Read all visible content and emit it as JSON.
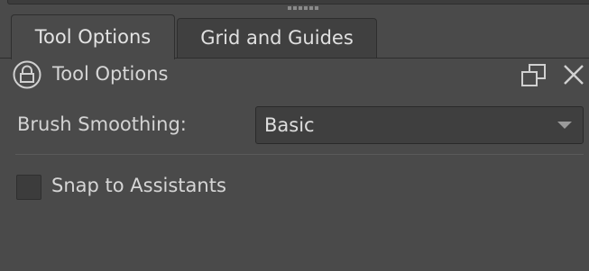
{
  "tabs": [
    {
      "label": "Tool Options",
      "active": true
    },
    {
      "label": "Grid and Guides",
      "active": false
    }
  ],
  "panel": {
    "title": "Tool Options",
    "icons": {
      "lock": "lock-icon",
      "float": "float-icon",
      "close": "close-icon"
    }
  },
  "brush_smoothing": {
    "label": "Brush Smoothing:",
    "value": "Basic"
  },
  "snap_to_assistants": {
    "label": "Snap to Assistants",
    "checked": false
  },
  "colors": {
    "background": "#4a4a4a",
    "text": "#d6d6d6",
    "combo_bg": "#3f3f3f"
  }
}
